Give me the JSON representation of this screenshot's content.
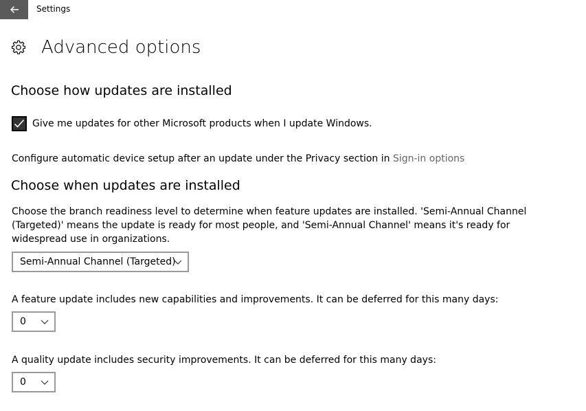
{
  "window": {
    "title": "Settings"
  },
  "header": {
    "title": "Advanced options"
  },
  "install_section": {
    "title": "Choose how updates are installed",
    "checkbox_label": "Give me updates for other Microsoft products when I update Windows.",
    "checkbox_checked": true,
    "configure_text": "Configure automatic device setup after an update under the Privacy section in ",
    "signin_link": "Sign-in options"
  },
  "when_section": {
    "title": "Choose when updates are installed",
    "description": "Choose the branch readiness level to determine when feature updates are installed. 'Semi-Annual Channel (Targeted)' means the update is ready for most people, and 'Semi-Annual Channel' means it's ready for widespread use in organizations.",
    "branch_selected": "Semi-Annual Channel (Targeted)",
    "feature_text": "A feature update includes new capabilities and improvements. It can be deferred for this many days:",
    "feature_days": "0",
    "quality_text": "A quality update includes security improvements. It can be deferred for this many days:",
    "quality_days": "0"
  },
  "colors": {
    "back_button_bg": "#5a5a5a",
    "link": "#666666",
    "dropdown_border": "#999999"
  },
  "icons": {
    "back": "back-arrow-icon",
    "settings": "gear-icon",
    "check": "checkmark-icon",
    "dropdown": "chevron-down-icon"
  }
}
